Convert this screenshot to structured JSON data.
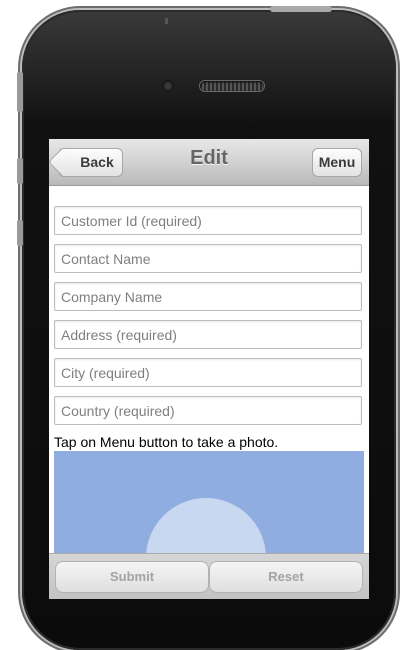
{
  "header": {
    "title": "Edit",
    "back_label": "Back",
    "menu_label": "Menu"
  },
  "form": {
    "customer_id": {
      "placeholder": "Customer Id (required)",
      "value": ""
    },
    "contact_name": {
      "placeholder": "Contact Name",
      "value": ""
    },
    "company_name": {
      "placeholder": "Company Name",
      "value": ""
    },
    "address": {
      "placeholder": "Address (required)",
      "value": ""
    },
    "city": {
      "placeholder": "City (required)",
      "value": ""
    },
    "country": {
      "placeholder": "Country (required)",
      "value": ""
    }
  },
  "photo_hint": "Tap on Menu button to take a photo.",
  "footer": {
    "submit_label": "Submit",
    "reset_label": "Reset"
  },
  "colors": {
    "photo_background": "#8fade0",
    "disabled_text": "#a3a3a3"
  }
}
